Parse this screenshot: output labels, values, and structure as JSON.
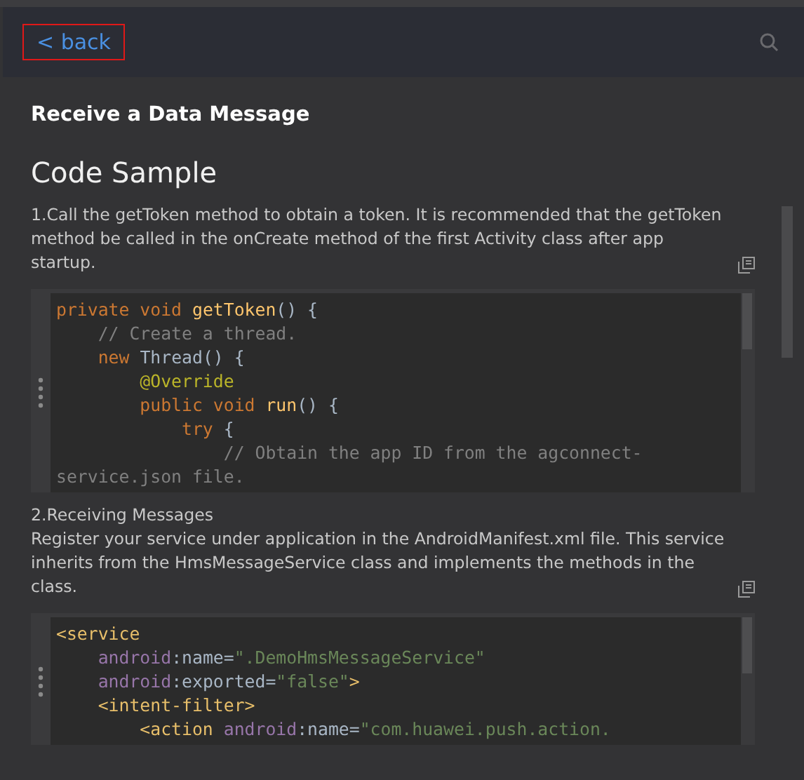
{
  "header": {
    "back_link": "< back"
  },
  "title": "Receive a Data Message",
  "heading": "Code Sample",
  "sections": [
    {
      "text": "1.Call the getToken method to obtain a token. It is recommended that the getToken method be called in the onCreate method of the first Activity class after app startup.",
      "code": [
        [
          {
            "kind": "keyword",
            "text": "private void "
          },
          {
            "kind": "method",
            "text": "getToken"
          },
          {
            "kind": "plain",
            "text": "() {"
          }
        ],
        [
          {
            "kind": "comment",
            "text": "    // Create a thread."
          }
        ],
        [
          {
            "kind": "keyword",
            "text": "    new "
          },
          {
            "kind": "plain",
            "text": "Thread() {"
          }
        ],
        [
          {
            "kind": "annotation",
            "text": "        @Override"
          }
        ],
        [
          {
            "kind": "keyword",
            "text": "        public void "
          },
          {
            "kind": "method",
            "text": "run"
          },
          {
            "kind": "plain",
            "text": "() {"
          }
        ],
        [
          {
            "kind": "keyword",
            "text": "            try "
          },
          {
            "kind": "plain",
            "text": "{"
          }
        ],
        [
          {
            "kind": "comment",
            "text": "                // Obtain the app ID from the agconnect-"
          }
        ],
        [
          {
            "kind": "comment",
            "text": "service.json file."
          }
        ]
      ]
    },
    {
      "lead": "2.Receiving Messages",
      "text": "Register your service under application in the AndroidManifest.xml file. This service inherits from the HmsMessageService class and implements the methods in the class.",
      "code": [
        [
          {
            "kind": "tag",
            "text": "<service"
          }
        ],
        [
          {
            "kind": "attrns",
            "text": "    android"
          },
          {
            "kind": "plain",
            "text": ":name="
          },
          {
            "kind": "string",
            "text": "\".DemoHmsMessageService\""
          }
        ],
        [
          {
            "kind": "attrns",
            "text": "    android"
          },
          {
            "kind": "plain",
            "text": ":exported="
          },
          {
            "kind": "string",
            "text": "\"false\""
          },
          {
            "kind": "tag",
            "text": ">"
          }
        ],
        [
          {
            "kind": "tag",
            "text": "    <intent-filter>"
          }
        ],
        [
          {
            "kind": "tag",
            "text": "        <action "
          },
          {
            "kind": "attrns",
            "text": "android"
          },
          {
            "kind": "plain",
            "text": ":name="
          },
          {
            "kind": "string",
            "text": "\"com.huawei.push.action."
          }
        ]
      ]
    }
  ]
}
